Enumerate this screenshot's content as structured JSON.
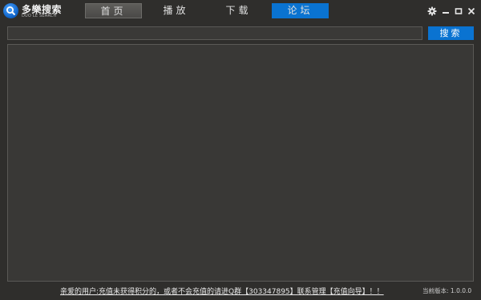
{
  "app": {
    "name": "多樂搜索",
    "subtitle": "DUO LE SEARCH"
  },
  "tabs": [
    {
      "label": "首页",
      "state": "hover"
    },
    {
      "label": "播放",
      "state": "normal"
    },
    {
      "label": "下载",
      "state": "normal"
    },
    {
      "label": "论坛",
      "state": "active"
    }
  ],
  "window_controls": [
    "gear-icon",
    "minimize-icon",
    "maximize-icon",
    "close-icon"
  ],
  "search": {
    "value": "",
    "placeholder": "",
    "button_label": "搜索"
  },
  "footer": {
    "notice": "亲爱的用户:充值未获得积分的，或者不会充值的请进Q群【303347895】联系管理【充值向导】！！",
    "version_label": "当前版本: 1.0.0.0"
  },
  "colors": {
    "background": "#2f2e2c",
    "accent": "#0a73d1",
    "panel": "#393836"
  }
}
